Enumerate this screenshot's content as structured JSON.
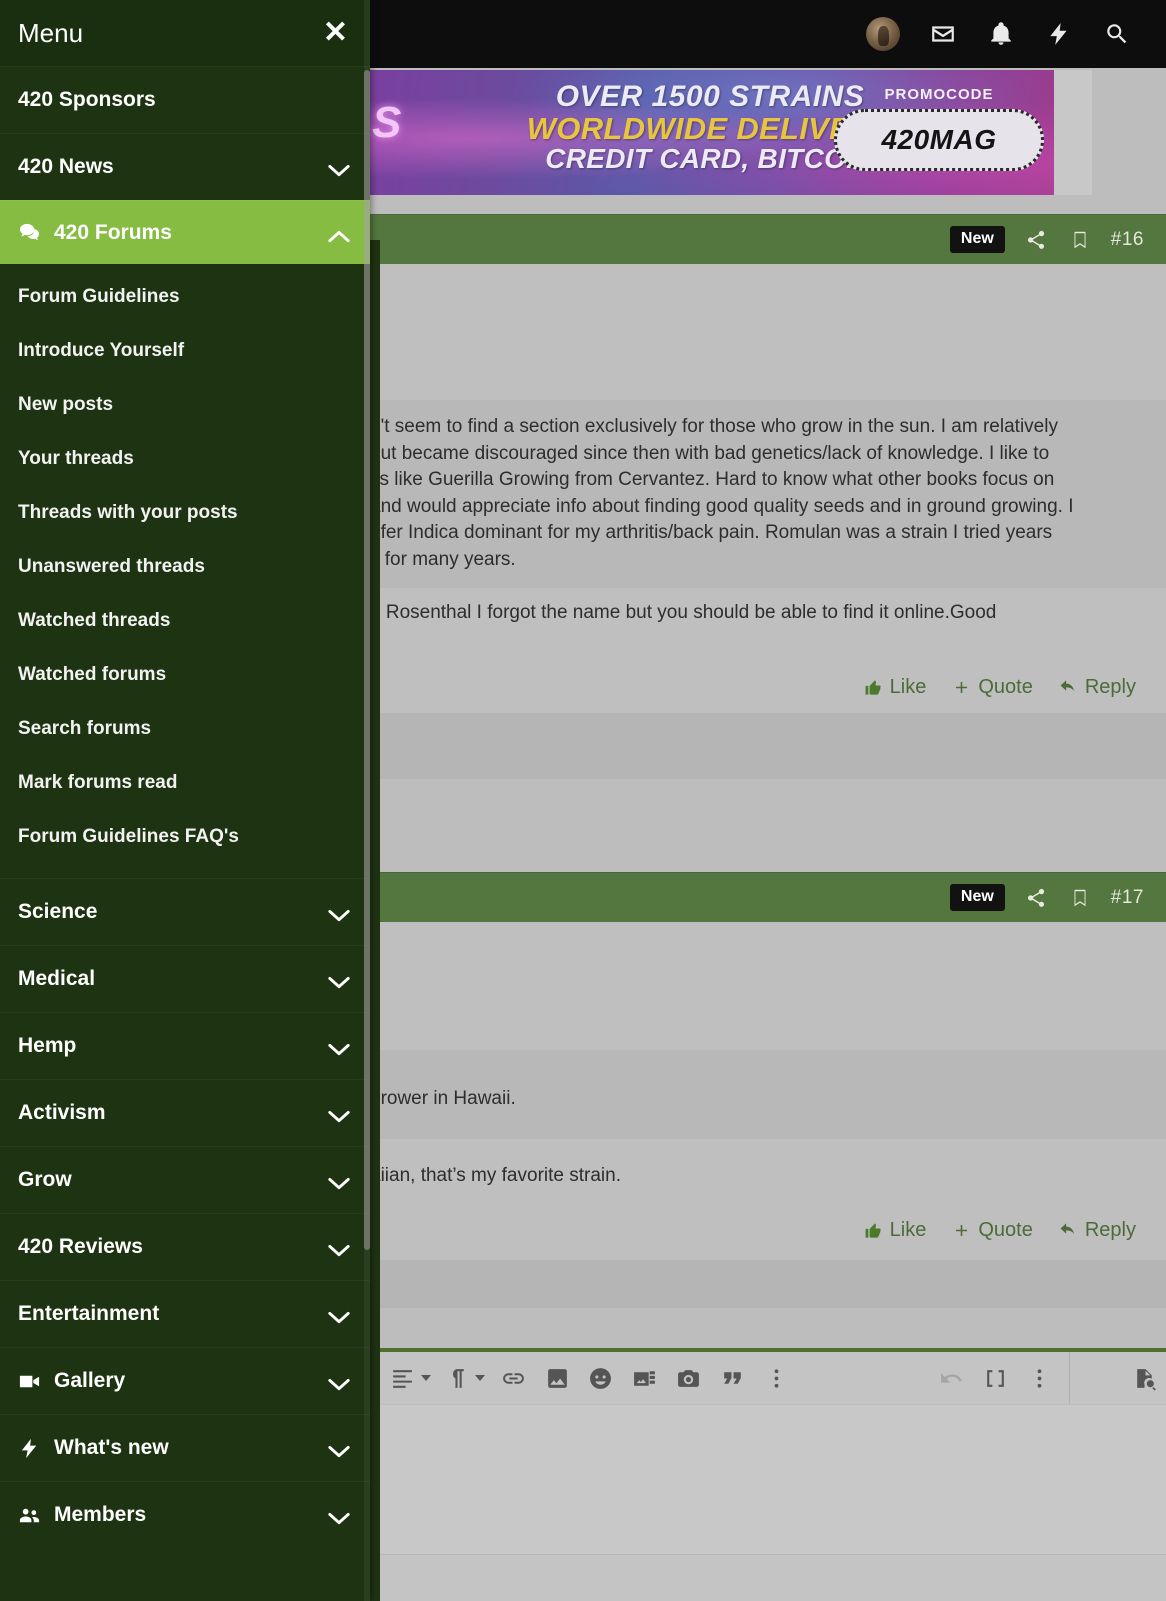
{
  "topbar": {
    "icons": [
      {
        "name": "user-avatar",
        "label": "Account"
      },
      {
        "name": "envelope-icon",
        "label": "Inbox"
      },
      {
        "name": "bell-icon",
        "label": "Alerts"
      },
      {
        "name": "bolt-icon",
        "label": "What's new"
      },
      {
        "name": "search-icon",
        "label": "Search"
      }
    ]
  },
  "banner": {
    "logo_fragment": "S",
    "line1": "OVER 1500 STRAINS",
    "line2": "WORLDWIDE DELIVERY",
    "line3": "CREDIT CARD, BITCOIN",
    "promo_label": "PROMOCODE",
    "promo_code": "420MAG",
    "accent_yellow": "#e8c53f"
  },
  "posts": [
    {
      "badge": "New",
      "number": "#16",
      "quote_lines": [
        "n't seem to find a section exclusively for those who grow in the sun. I am relatively",
        "but became discouraged since then with bad genetics/lack of knowledge. I like to",
        "ks like Guerilla Growing from Cervantez. Hard to know what other books focus on",
        "and would appreciate info about finding good quality seeds and in ground growing. I",
        "efer Indica dominant for my arthritis/back pain. Romulan was a strain I tried years",
        "it for many years."
      ],
      "reply_lines": [
        "d Rosenthal I forgot the name but you should be able to find it online.Good",
        "."
      ],
      "actions": {
        "like": "Like",
        "quote": "Quote",
        "reply": "Reply"
      }
    },
    {
      "badge": "New",
      "number": "#17",
      "quote_lines": [
        "grower in Hawaii."
      ],
      "reply_lines": [
        "aiian, that’s my favorite strain."
      ],
      "actions": {
        "like": "Like",
        "quote": "Quote",
        "reply": "Reply"
      }
    }
  ],
  "editor": {
    "tools": [
      {
        "name": "align-dropdown-icon",
        "glyph": "align"
      },
      {
        "name": "text-direction-dropdown-icon",
        "glyph": "pilcrow"
      },
      {
        "name": "insert-link-icon",
        "glyph": "link"
      },
      {
        "name": "insert-image-icon",
        "glyph": "image"
      },
      {
        "name": "insert-emoji-icon",
        "glyph": "smiley"
      },
      {
        "name": "insert-media-icon",
        "glyph": "media"
      },
      {
        "name": "insert-camera-icon",
        "glyph": "camera"
      },
      {
        "name": "insert-quote-icon",
        "glyph": "quote"
      },
      {
        "name": "more-options-icon",
        "glyph": "kebab"
      }
    ],
    "tools_right": [
      {
        "name": "undo-icon",
        "glyph": "undo",
        "disabled": true
      },
      {
        "name": "insert-bbcode-icon",
        "glyph": "brackets"
      },
      {
        "name": "more-options-icon",
        "glyph": "kebab"
      }
    ],
    "tools_far_right": [
      {
        "name": "preview-icon",
        "glyph": "preview"
      }
    ]
  },
  "menu": {
    "title": "Menu",
    "close_label": "✕",
    "items": [
      {
        "label": "420 Sponsors",
        "icon": null,
        "chevron": false,
        "active": false
      },
      {
        "label": "420 News",
        "icon": null,
        "chevron": "down",
        "active": false
      },
      {
        "label": "420 Forums",
        "icon": "comments-icon",
        "chevron": "up",
        "active": true
      }
    ],
    "sub_items": [
      {
        "label": "Forum Guidelines"
      },
      {
        "label": "Introduce Yourself"
      },
      {
        "label": "New posts"
      },
      {
        "label": "Your threads"
      },
      {
        "label": "Threads with your posts"
      },
      {
        "label": "Unanswered threads"
      },
      {
        "label": "Watched threads"
      },
      {
        "label": "Watched forums"
      },
      {
        "label": "Search forums"
      },
      {
        "label": "Mark forums read"
      },
      {
        "label": "Forum Guidelines FAQ's"
      }
    ],
    "items_after": [
      {
        "label": "Science",
        "icon": null,
        "chevron": "down"
      },
      {
        "label": "Medical",
        "icon": null,
        "chevron": "down"
      },
      {
        "label": "Hemp",
        "icon": null,
        "chevron": "down"
      },
      {
        "label": "Activism",
        "icon": null,
        "chevron": "down"
      },
      {
        "label": "Grow",
        "icon": null,
        "chevron": "down"
      },
      {
        "label": "420 Reviews",
        "icon": null,
        "chevron": "down"
      },
      {
        "label": "Entertainment",
        "icon": null,
        "chevron": "down"
      },
      {
        "label": "Gallery",
        "icon": "video-camera-icon",
        "chevron": "down"
      },
      {
        "label": "What's new",
        "icon": "bolt-icon",
        "chevron": "down"
      },
      {
        "label": "Members",
        "icon": "users-icon",
        "chevron": "down"
      }
    ],
    "colors": {
      "background": "#1d3311",
      "active": "#86bc42",
      "text": "#ffffff"
    }
  }
}
